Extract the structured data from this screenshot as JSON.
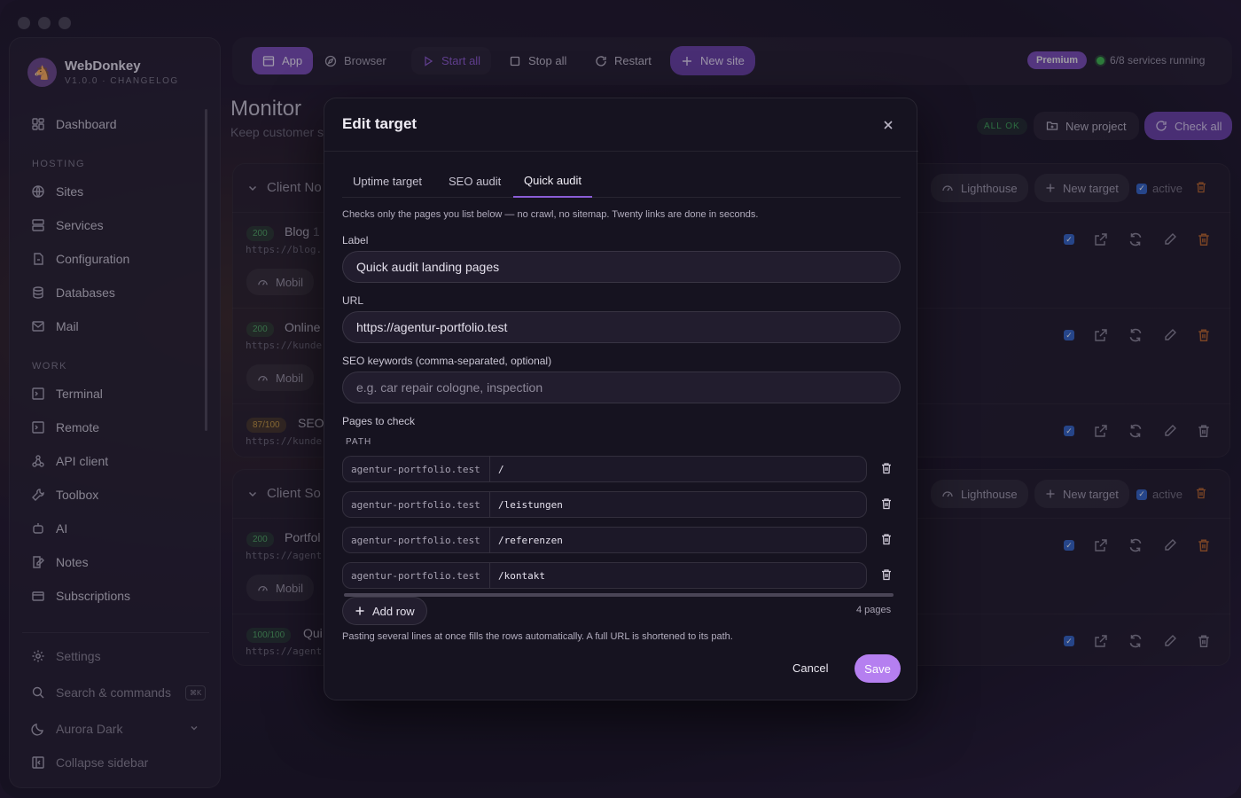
{
  "app": {
    "name": "WebDonkey",
    "version": "V1.0.0 · CHANGELOG"
  },
  "sidebar": {
    "dashboard": "Dashboard",
    "hosting_label": "HOSTING",
    "hosting": [
      "Sites",
      "Services",
      "Configuration",
      "Databases",
      "Mail"
    ],
    "work_label": "WORK",
    "work": [
      "Terminal",
      "Remote",
      "API client",
      "Toolbox",
      "AI",
      "Notes",
      "Subscriptions"
    ],
    "settings": "Settings",
    "search": "Search & commands",
    "search_kbd": "⌘K",
    "theme": "Aurora Dark",
    "collapse": "Collapse sidebar"
  },
  "toolbar": {
    "app": "App",
    "browser": "Browser",
    "start_all": "Start all",
    "stop_all": "Stop all",
    "restart": "Restart",
    "new_site": "New site",
    "premium": "Premium",
    "running": "6/8 services running"
  },
  "page": {
    "title": "Monitor",
    "subtitle": "Keep customer s",
    "all_ok": "ALL OK",
    "new_project": "New project",
    "check_all": "Check all"
  },
  "groups": [
    {
      "name": "Client No",
      "lighthouse": "Lighthouse",
      "new_target": "New target",
      "active": "active"
    },
    {
      "name": "Client So",
      "lighthouse": "Lighthouse",
      "new_target": "New target",
      "active": "active"
    }
  ],
  "rows": [
    {
      "badge": "200",
      "title": "Blog",
      "title_suffix": "1",
      "url": "https://blog.",
      "device": "Mobil"
    },
    {
      "badge": "200",
      "title": "Online",
      "url": "https://kunde",
      "device": "Mobil"
    },
    {
      "badge": "87/100",
      "title": "SEO",
      "url": "https://kunde"
    },
    {
      "badge": "200",
      "title": "Portfol",
      "url": "https://agent",
      "device": "Mobil"
    },
    {
      "badge": "100/100",
      "title": "Qui",
      "url": "https://agent"
    }
  ],
  "modal": {
    "title": "Edit target",
    "tabs": [
      "Uptime target",
      "SEO audit",
      "Quick audit"
    ],
    "active_tab": "Quick audit",
    "description": "Checks only the pages you list below — no crawl, no sitemap. Twenty links are done in seconds.",
    "label_label": "Label",
    "label_value": "Quick audit landing pages",
    "url_label": "URL",
    "url_value": "https://agentur-portfolio.test",
    "keywords_label": "SEO keywords (comma-separated, optional)",
    "keywords_placeholder": "e.g. car repair cologne, inspection",
    "pages_label": "Pages to check",
    "path_header": "PATH",
    "pages": [
      {
        "host": "agentur-portfolio.test",
        "path": "/"
      },
      {
        "host": "agentur-portfolio.test",
        "path": "/leistungen"
      },
      {
        "host": "agentur-portfolio.test",
        "path": "/referenzen"
      },
      {
        "host": "agentur-portfolio.test",
        "path": "/kontakt"
      }
    ],
    "add_row": "Add row",
    "page_count": "4 pages",
    "hint": "Pasting several lines at once fills the rows automatically. A full URL is shortened to its path.",
    "cancel": "Cancel",
    "save": "Save"
  }
}
